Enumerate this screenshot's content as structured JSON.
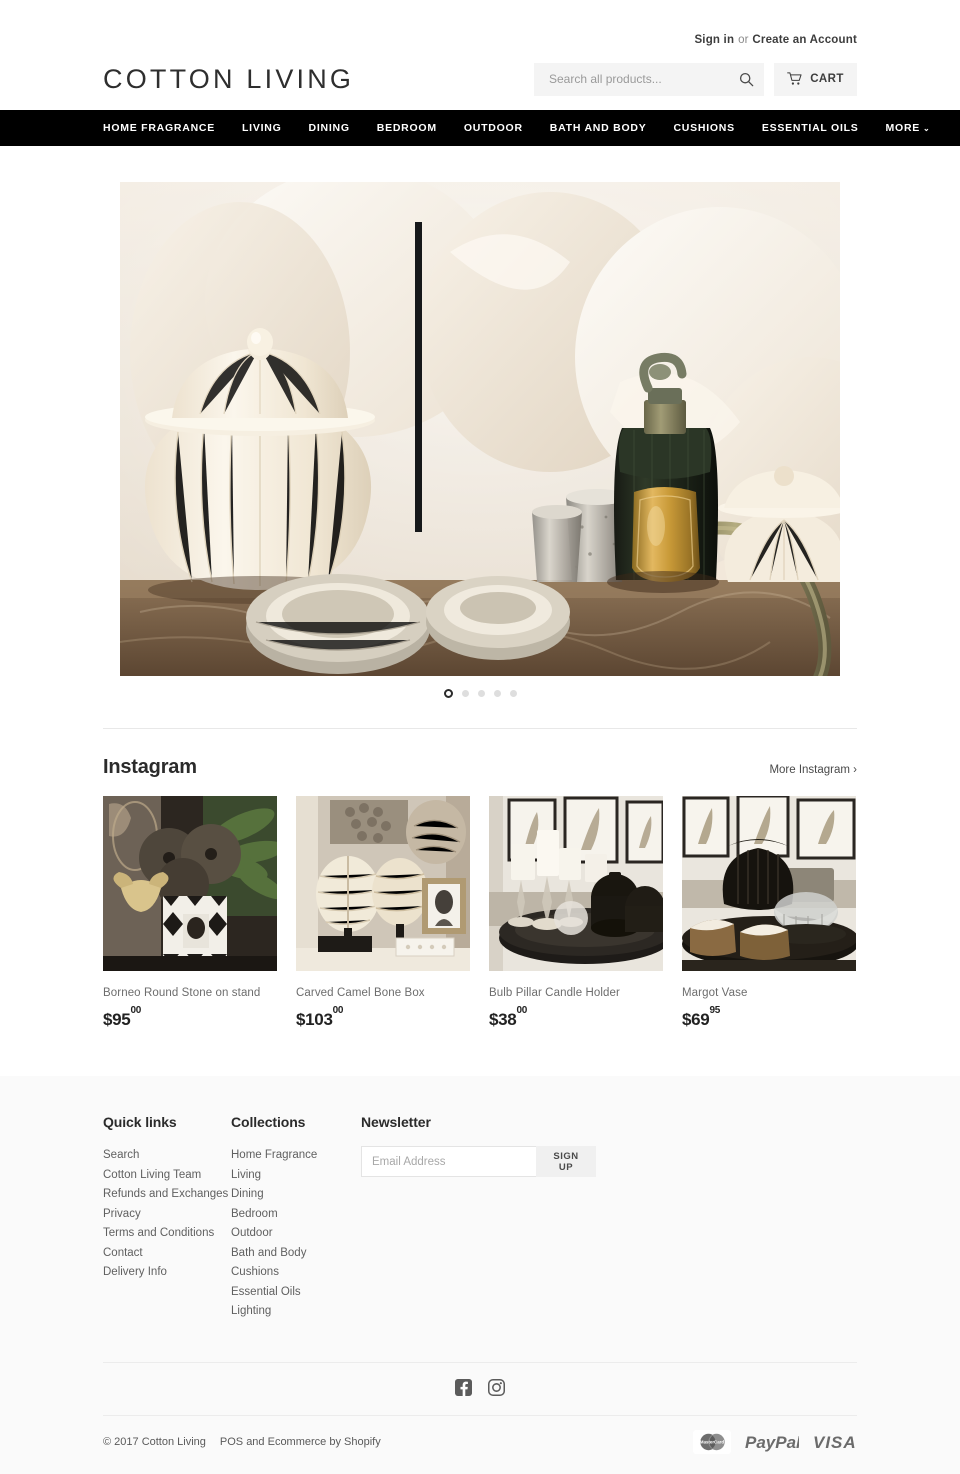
{
  "utility": {
    "sign_in": "Sign in",
    "or": "or",
    "create_account": "Create an Account"
  },
  "header": {
    "logo": "COTTON LIVING",
    "search_placeholder": "Search all products...",
    "search_value": "",
    "search_icon": "search-icon",
    "cart_label": "CART",
    "cart_icon": "shopping-cart-icon"
  },
  "nav": {
    "items": [
      {
        "label": "HOME FRAGRANCE",
        "has_chevron": false
      },
      {
        "label": "LIVING",
        "has_chevron": false
      },
      {
        "label": "DINING",
        "has_chevron": false
      },
      {
        "label": "BEDROOM",
        "has_chevron": false
      },
      {
        "label": "OUTDOOR",
        "has_chevron": false
      },
      {
        "label": "BATH AND BODY",
        "has_chevron": false
      },
      {
        "label": "CUSHIONS",
        "has_chevron": false
      },
      {
        "label": "ESSENTIAL OILS",
        "has_chevron": false
      },
      {
        "label": "MORE",
        "has_chevron": true
      }
    ],
    "chevron_icon": "chevron-down-icon"
  },
  "hero": {
    "alt": "Cream ceramic vessels and dark green gold perfume atomizer on table with white cushions",
    "slide_count": 5,
    "active_slide": 1
  },
  "instagram": {
    "title": "Instagram",
    "more_label": "More Instagram ›",
    "products": [
      {
        "title": "Borneo Round Stone on stand",
        "price_dollars": "$95",
        "price_cents": "00"
      },
      {
        "title": "Carved Camel Bone Box",
        "price_dollars": "$103",
        "price_cents": "00"
      },
      {
        "title": "Bulb Pillar Candle Holder",
        "price_dollars": "$38",
        "price_cents": "00"
      },
      {
        "title": "Margot Vase",
        "price_dollars": "$69",
        "price_cents": "95"
      }
    ]
  },
  "footer": {
    "quick_links": {
      "heading": "Quick links",
      "items": [
        "Search",
        "Cotton Living Team",
        "Refunds and Exchanges",
        "Privacy",
        "Terms and Conditions",
        "Contact",
        "Delivery Info"
      ]
    },
    "collections": {
      "heading": "Collections",
      "items": [
        "Home Fragrance",
        "Living",
        "Dining",
        "Bedroom",
        "Outdoor",
        "Bath and Body",
        "Cushions",
        "Essential Oils",
        "Lighting"
      ]
    },
    "newsletter": {
      "heading": "Newsletter",
      "placeholder": "Email Address",
      "value": "",
      "button": "SIGN UP"
    },
    "social": [
      {
        "name": "facebook-icon"
      },
      {
        "name": "instagram-icon"
      }
    ],
    "copyright": "© 2017 Cotton Living",
    "shopify_link": "POS and Ecommerce by Shopify",
    "payments": [
      "mastercard",
      "paypal",
      "visa"
    ]
  },
  "colors": {
    "nav_bg": "#000000",
    "page_bg": "#ffffff",
    "footer_bg": "#fafafa",
    "text": "#3d3d3d",
    "muted": "#6d6d6d",
    "field_bg": "#f4f4f4"
  }
}
